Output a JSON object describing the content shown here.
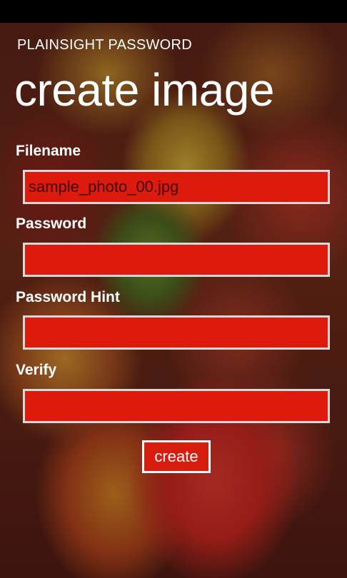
{
  "app": {
    "title": "PLAINSIGHT PASSWORD"
  },
  "page": {
    "title": "create image"
  },
  "form": {
    "filename": {
      "label": "Filename",
      "value": "sample_photo_00.jpg",
      "placeholder": ""
    },
    "password": {
      "label": "Password",
      "value": "",
      "placeholder": ""
    },
    "password_hint": {
      "label": "Password Hint",
      "value": "",
      "placeholder": ""
    },
    "verify": {
      "label": "Verify",
      "value": "",
      "placeholder": ""
    },
    "create_label": "create"
  },
  "colors": {
    "field_fill": "#dd1a0b",
    "field_border": "#d9d9d9",
    "button_fill": "#d81c0d",
    "text": "#ffffff"
  }
}
